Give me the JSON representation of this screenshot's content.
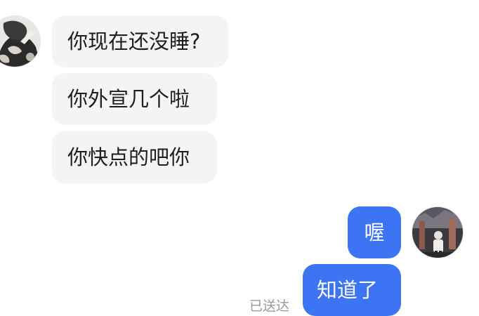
{
  "chat": {
    "incoming": [
      {
        "text": "你现在还没睡?"
      },
      {
        "text": "你外宣几个啦"
      },
      {
        "text": "你快点的吧你"
      }
    ],
    "outgoing": [
      {
        "text": "喔"
      },
      {
        "text": "知道了"
      }
    ],
    "status_text": "已送达"
  },
  "colors": {
    "incoming_bubble": "#f4f4f4",
    "outgoing_bubble": "#3d74f4",
    "status_text": "#9a9a9a"
  },
  "icons": {
    "left_avatar": "contact-avatar",
    "right_avatar": "user-avatar"
  }
}
